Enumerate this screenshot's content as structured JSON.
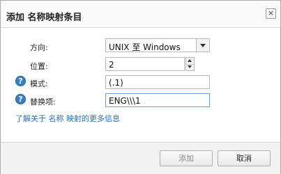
{
  "dialog": {
    "title": "添加 名称映射条目",
    "close_symbol": "×"
  },
  "form": {
    "direction_label": "方向:",
    "direction_value": "UNIX 至 Windows",
    "position_label": "位置:",
    "position_value": "2",
    "pattern_label": "模式:",
    "pattern_value": "(.1)",
    "replacement_label": "替换项:",
    "replacement_value": "ENG\\\\\\1",
    "help_symbol": "?"
  },
  "link_text": "了解关于 名称 映射的更多信息",
  "footer": {
    "add_label": "添加",
    "cancel_label": "取消"
  },
  "colors": {
    "help_icon": "#3a7ec3",
    "link": "#2b6fb6",
    "active_border": "#6a9ed6"
  },
  "icons": {
    "close": "close-icon",
    "help": "help-icon",
    "dropdown": "chevron-down-icon",
    "spinner_up": "spinner-up-icon",
    "spinner_down": "spinner-down-icon"
  }
}
